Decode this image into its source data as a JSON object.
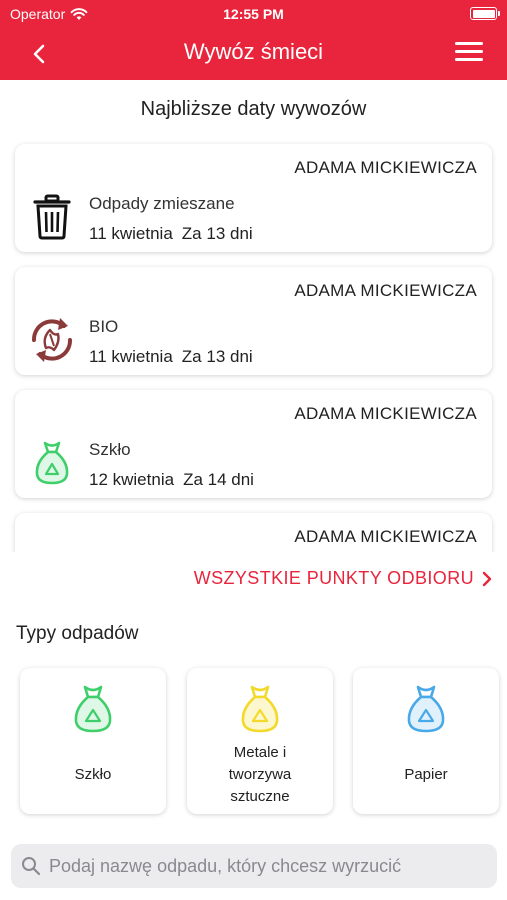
{
  "status_bar": {
    "carrier": "Operator",
    "time": "12:55 PM"
  },
  "header": {
    "title": "Wywóz śmieci"
  },
  "upcoming": {
    "title": "Najbliższe daty wywozów",
    "items": [
      {
        "street": "ADAMA MICKIEWICZA",
        "type": "Odpady zmieszane",
        "date": "11 kwietnia",
        "relative": "Za 13 dni",
        "icon": "trash-bin-icon"
      },
      {
        "street": "ADAMA MICKIEWICZA",
        "type": "BIO",
        "date": "11 kwietnia",
        "relative": "Za 13 dni",
        "icon": "bio-recycle-icon"
      },
      {
        "street": "ADAMA MICKIEWICZA",
        "type": "Szkło",
        "date": "12 kwietnia",
        "relative": "Za 14 dni",
        "icon": "green-recycle-bag-icon"
      },
      {
        "street": "ADAMA MICKIEWICZA"
      }
    ]
  },
  "all_points_link": "WSZYSTKIE PUNKTY ODBIORU",
  "waste_types": {
    "title": "Typy odpadów",
    "items": [
      {
        "label": "Szkło",
        "color": "#3ecf6b",
        "icon": "green-recycle-bag-icon"
      },
      {
        "label": "Metale i tworzywa sztuczne",
        "color": "#f2d92a",
        "icon": "yellow-recycle-bag-icon"
      },
      {
        "label": "Papier",
        "color": "#49a8e8",
        "icon": "blue-recycle-bag-icon"
      }
    ]
  },
  "search": {
    "placeholder": "Podaj nazwę odpadu, który chcesz wyrzucić",
    "value": ""
  },
  "colors": {
    "accent": "#e8253c",
    "bio": "#8b3a3a"
  }
}
